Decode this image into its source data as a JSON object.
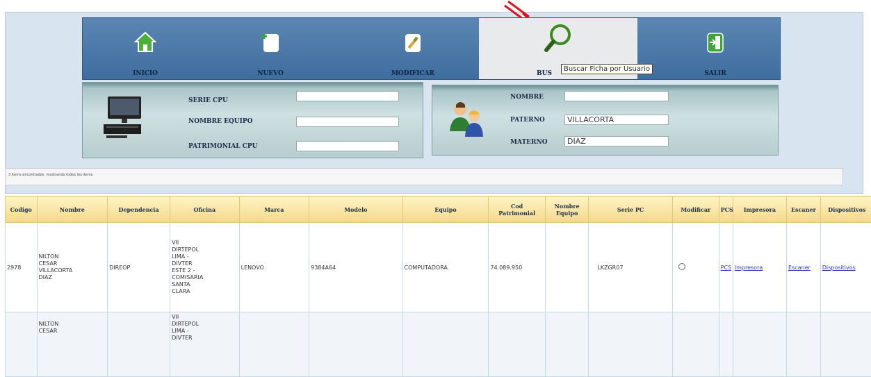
{
  "toolbar": {
    "items": [
      {
        "label": "INICIO",
        "icon": "home-icon"
      },
      {
        "label": "NUEVO",
        "icon": "new-document-icon"
      },
      {
        "label": "MODIFICAR",
        "icon": "edit-icon"
      },
      {
        "label": "BUS",
        "icon": "search-icon"
      },
      {
        "label": "SALIR",
        "icon": "exit-icon"
      }
    ],
    "tooltip": "Buscar Ficha por Usuario"
  },
  "equipment_search": {
    "serie_cpu_label": "SERIE CPU",
    "serie_cpu_value": "",
    "nombre_equipo_label": "NOMBRE EQUIPO",
    "nombre_equipo_value": "",
    "patrimonial_cpu_label": "PATRIMONIAL CPU",
    "patrimonial_cpu_value": ""
  },
  "user_search": {
    "nombre_label": "NOMBRE",
    "nombre_value": "",
    "paterno_label": "PATERNO",
    "paterno_value": "VILLACORTA",
    "materno_label": "MATERNO",
    "materno_value": "DIAZ"
  },
  "message": "3 items encontrados. mostrando todos los items.",
  "table": {
    "headers": [
      "Codigo",
      "Nombre",
      "Dependencia",
      "Oficina",
      "Marca",
      "Modelo",
      "Equipo",
      "Cod\nPatrimonial",
      "Nombre\nEquipo",
      "Serie PC",
      "Modificar",
      "PCS",
      "Impresora",
      "Escaner",
      "Dispositivos"
    ],
    "rows": [
      {
        "codigo": "2978",
        "nombre": "NILTON\nCESAR\nVILLACORTA\nDIAZ",
        "dependencia": "DIREOP",
        "oficina": "VII\nDIRTEPOL\nLIMA -\nDIVTER\nESTE 2 -\nCOMISARIA\nSANTA\nCLARA",
        "marca": "LENOVO",
        "modelo": "9384A64",
        "equipo": "COMPUTADORA",
        "cod_patrimonial": "74.089.950",
        "nombre_equipo": "",
        "serie_pc": "LKZGR07",
        "pcs": "PCS",
        "impresora": "Impresora",
        "escaner": "Escaner",
        "dispositivos": "Dispositivos"
      },
      {
        "codigo": "",
        "nombre": "NILTON\nCESAR",
        "dependencia": "",
        "oficina": "VII\nDIRTEPOL\nLIMA -\nDIVTER",
        "marca": "",
        "modelo": "",
        "equipo": "",
        "cod_patrimonial": "",
        "nombre_equipo": "",
        "serie_pc": "",
        "pcs": "",
        "impresora": "",
        "escaner": "",
        "dispositivos": ""
      }
    ]
  },
  "colors": {
    "toolbar": "#4a78a8",
    "header": "#f7e3a0",
    "link": "#2c36c9",
    "arrow": "#e0141e"
  }
}
